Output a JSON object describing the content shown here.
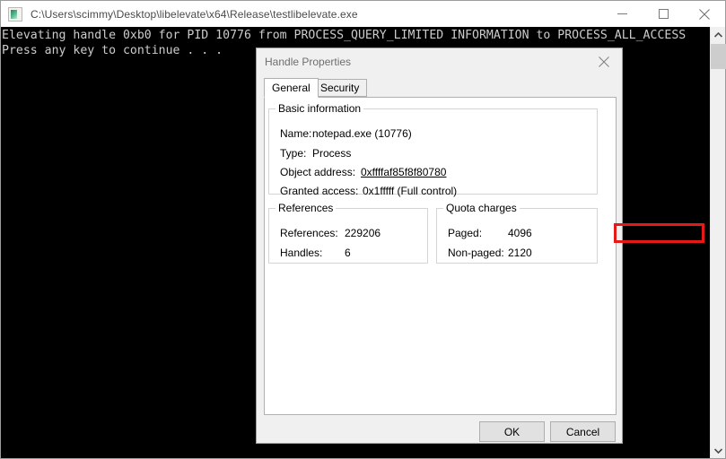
{
  "console_window": {
    "title": "C:\\Users\\scimmy\\Desktop\\libelevate\\x64\\Release\\testlibelevate.exe",
    "icon": "console-icon",
    "controls": {
      "minimize": "minimize-icon",
      "maximize": "maximize-icon",
      "close": "close-icon"
    },
    "output": "Elevating handle 0xb0 for PID 10776 from PROCESS_QUERY_LIMITED INFORMATION to PROCESS_ALL_ACCESS\nPress any key to continue . . .",
    "scrollbar": {
      "up_arrow": "chevron-up-icon",
      "down_arrow": "chevron-down-icon"
    }
  },
  "dialog": {
    "title": "Handle Properties",
    "close_icon": "close-icon",
    "tabs": [
      {
        "label": "General",
        "active": true
      },
      {
        "label": "Security",
        "active": false
      }
    ],
    "groups": {
      "basic": {
        "legend": "Basic information",
        "fields": [
          {
            "label": "Name:",
            "value": "notepad.exe (10776)"
          },
          {
            "label": "Type:",
            "value": "Process"
          },
          {
            "label": "Object address:",
            "value": "0xffffaf85f8f80780"
          },
          {
            "label": "Granted access:",
            "value": "0x1fffff (Full control)"
          }
        ]
      },
      "references": {
        "legend": "References",
        "fields": [
          {
            "label": "References:",
            "value": "229206"
          },
          {
            "label": "Handles:",
            "value": "6"
          }
        ]
      },
      "quota": {
        "legend": "Quota charges",
        "fields": [
          {
            "label": "Paged:",
            "value": "4096"
          },
          {
            "label": "Non-paged:",
            "value": "2120"
          }
        ]
      }
    },
    "buttons": {
      "ok": "OK",
      "cancel": "Cancel"
    },
    "annotation": {
      "type": "red-highlight-rectangle",
      "color": "#e61919",
      "targets": "granted-access-value"
    }
  }
}
